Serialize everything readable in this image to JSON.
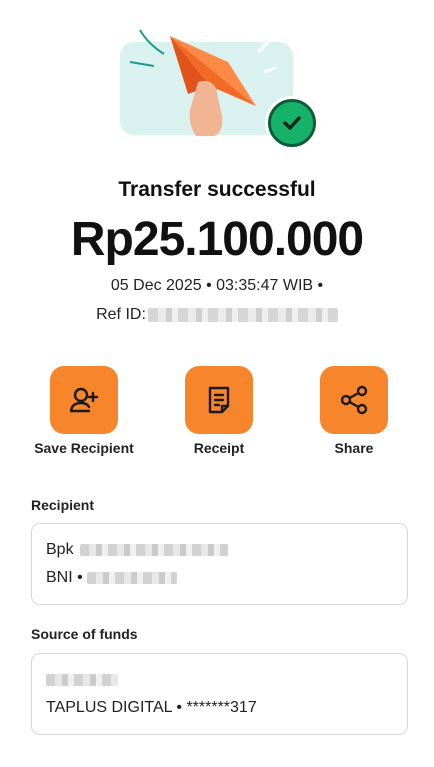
{
  "header": {
    "title": "Transfer successful",
    "amount": "Rp25.100.000",
    "datetime": "05 Dec 2025 • 03:35:47 WIB •",
    "ref_label": "Ref ID: "
  },
  "icons": {
    "hero": "paper-plane-hand-illustration",
    "check": "checkmark-icon",
    "save": "add-user-icon",
    "receipt": "receipt-icon",
    "share": "share-icon"
  },
  "actions": [
    {
      "label": "Save Recipient"
    },
    {
      "label": "Receipt"
    },
    {
      "label": "Share"
    }
  ],
  "recipient": {
    "label": "Recipient",
    "name_prefix": "Bpk",
    "bank_prefix": "BNI •"
  },
  "source": {
    "label": "Source of funds",
    "account": "TAPLUS DIGITAL • *******317"
  },
  "colors": {
    "accent": "#f7852b",
    "success": "#17b26a",
    "hero_bg": "#d9f1ef"
  }
}
